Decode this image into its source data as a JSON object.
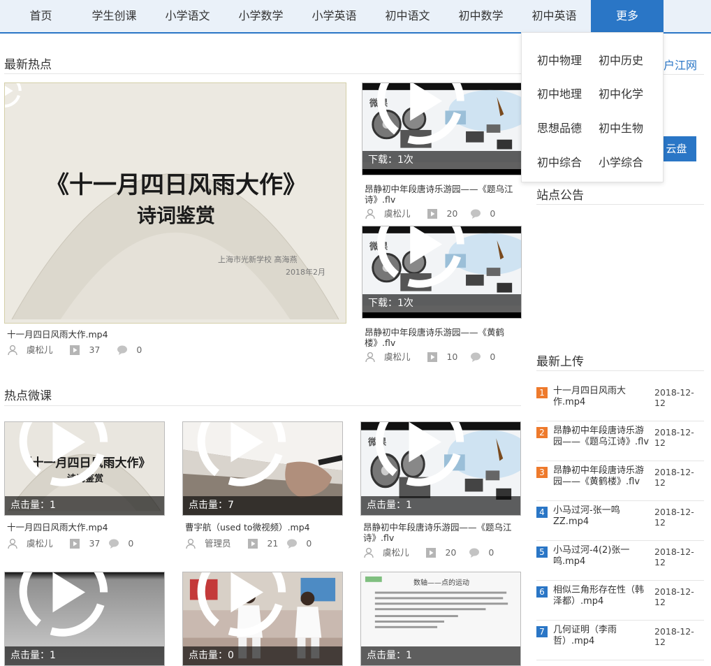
{
  "nav": {
    "items": [
      "首页",
      "学生创课",
      "小学语文",
      "小学数学",
      "小学英语",
      "初中语文",
      "初中数学",
      "初中英语",
      "更多"
    ]
  },
  "dropdown": {
    "items": [
      "初中物理",
      "初中历史",
      "初中地理",
      "初中化学",
      "思想品德",
      "初中生物",
      "初中综合",
      "小学综合"
    ]
  },
  "hot_new": {
    "title": "最新热点",
    "main": {
      "thumb_title": "《十一月四日风雨大作》",
      "thumb_subtitle": "诗词鉴赏",
      "thumb_school": "上海市光新学校    高海燕",
      "thumb_date": "2018年2月",
      "title": "十一月四日风雨大作.mp4",
      "author": "虞松儿",
      "views": "37",
      "comments": "0"
    },
    "side": [
      {
        "badge": "微课",
        "overlay_label": "下载：",
        "overlay_value": "1次",
        "title": "昂静初中年段唐诗乐游园——《题乌江诗》.flv",
        "author": "虞松儿",
        "views": "20",
        "comments": "0"
      },
      {
        "badge": "微课",
        "overlay_label": "下载：",
        "overlay_value": "1次",
        "title": "昂静初中年段唐诗乐游园——《黄鹤楼》.flv",
        "author": "虞松儿",
        "views": "10",
        "comments": "0"
      }
    ]
  },
  "hot_micro": {
    "title": "热点微课",
    "items": [
      {
        "overlay_label": "点击量：",
        "overlay_value": "1",
        "thumb_title": "《十一月四日风雨大作》",
        "thumb_subtitle": "诗词鉴赏",
        "title": "十一月四日风雨大作.mp4",
        "author": "虞松儿",
        "views": "37",
        "comments": "0"
      },
      {
        "overlay_label": "点击量：",
        "overlay_value": "7",
        "title": "曹宇航（used to微视频）.mp4",
        "author": "管理员",
        "views": "21",
        "comments": "0"
      },
      {
        "overlay_label": "点击量：",
        "overlay_value": "1",
        "badge": "微课",
        "title": "昂静初中年段唐诗乐游园——《题乌江诗》.flv",
        "author": "虞松儿",
        "views": "20",
        "comments": "0"
      },
      {
        "overlay_label": "点击量：",
        "overlay_value": "1"
      },
      {
        "overlay_label": "点击量：",
        "overlay_value": "0"
      },
      {
        "overlay_label": "点击量：",
        "overlay_value": "1",
        "doc_title": "数轴——点的运动"
      }
    ]
  },
  "sidebar": {
    "site_link": "户江网",
    "cloud_button": "云盘",
    "notice_title": "站点公告",
    "upload_title": "最新上传",
    "uploads": [
      {
        "num": "1",
        "name": "十一月四日风雨大作.mp4",
        "date": "2018-12-12"
      },
      {
        "num": "2",
        "name": "昂静初中年段唐诗乐游园——《题乌江诗》.flv",
        "date": "2018-12-12"
      },
      {
        "num": "3",
        "name": "昂静初中年段唐诗乐游园——《黄鹤楼》.flv",
        "date": "2018-12-12"
      },
      {
        "num": "4",
        "name": "小马过河-张一鸣ZZ.mp4",
        "date": "2018-12-12"
      },
      {
        "num": "5",
        "name": "小马过河-4(2)张一鸣.mp4",
        "date": "2018-12-12"
      },
      {
        "num": "6",
        "name": "相似三角形存在性（韩泽都）.mp4",
        "date": "2018-12-12"
      },
      {
        "num": "7",
        "name": "几何证明（李雨哲）.mp4",
        "date": "2018-12-12"
      }
    ]
  },
  "colors": {
    "accent": "#2a76c6",
    "rank_top": "#ee7a2c",
    "rank_other": "#2a76c6"
  }
}
